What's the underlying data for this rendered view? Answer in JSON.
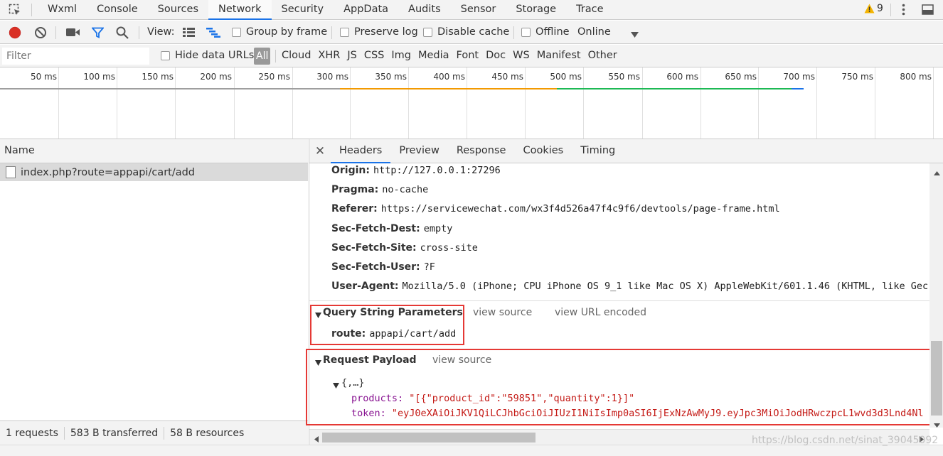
{
  "top_tabs": [
    "Wxml",
    "Console",
    "Sources",
    "Network",
    "Security",
    "AppData",
    "Audits",
    "Sensor",
    "Storage",
    "Trace"
  ],
  "active_top_tab": "Network",
  "warning_count": "9",
  "toolbar": {
    "view_label": "View:",
    "group_by_frame": "Group by frame",
    "preserve_log": "Preserve log",
    "disable_cache": "Disable cache",
    "offline": "Offline",
    "throttle": "Online"
  },
  "filter": {
    "placeholder": "Filter",
    "hide_data_urls": "Hide data URLs",
    "types": [
      "All",
      "Cloud",
      "XHR",
      "JS",
      "CSS",
      "Img",
      "Media",
      "Font",
      "Doc",
      "WS",
      "Manifest",
      "Other"
    ]
  },
  "timeline": {
    "ticks": [
      "50 ms",
      "100 ms",
      "150 ms",
      "200 ms",
      "250 ms",
      "300 ms",
      "350 ms",
      "400 ms",
      "450 ms",
      "500 ms",
      "550 ms",
      "600 ms",
      "650 ms",
      "700 ms",
      "750 ms",
      "800 ms"
    ],
    "colors": {
      "queue": "#9e9e9e",
      "waiting": "#f29900",
      "download": "#1db954",
      "content": "#1a73e8"
    }
  },
  "requests": {
    "name_header": "Name",
    "items": [
      "index.php?route=appapi/cart/add"
    ]
  },
  "status": {
    "requests": "1 requests",
    "transferred": "583 B transferred",
    "resources": "58 B resources"
  },
  "detail_tabs": [
    "Headers",
    "Preview",
    "Response",
    "Cookies",
    "Timing"
  ],
  "headers": [
    {
      "k": "Origin:",
      "v": "http://127.0.0.1:27296"
    },
    {
      "k": "Pragma:",
      "v": "no-cache"
    },
    {
      "k": "Referer:",
      "v": "https://servicewechat.com/wx3f4d526a47f4c9f6/devtools/page-frame.html"
    },
    {
      "k": "Sec-Fetch-Dest:",
      "v": "empty"
    },
    {
      "k": "Sec-Fetch-Site:",
      "v": "cross-site"
    },
    {
      "k": "Sec-Fetch-User:",
      "v": "?F"
    },
    {
      "k": "User-Agent:",
      "v": "Mozilla/5.0 (iPhone; CPU iPhone OS 9_1 like Mac OS X) AppleWebKit/601.1.46 (KHTML, like Gec"
    }
  ],
  "query": {
    "title": "Query String Parameters",
    "view_source": "view source",
    "view_url_encoded": "view URL encoded",
    "param_key": "route:",
    "param_val": "appapi/cart/add"
  },
  "payload": {
    "title": "Request Payload",
    "view_source": "view source",
    "root": "{,…}",
    "products_key": "products:",
    "products_val": "\"[{\"product_id\":\"59851\",\"quantity\":1}]\"",
    "token_key": "token:",
    "token_val": "\"eyJ0eXAiOiJKV1QiLCJhbGciOiJIUzI1NiIsImp0aSI6IjExNzAwMyJ9.eyJpc3MiOiJodHRwczpcL1wvd3d3Lnd4Nl"
  },
  "watermark": "https://blog.csdn.net/sinat_39045092"
}
